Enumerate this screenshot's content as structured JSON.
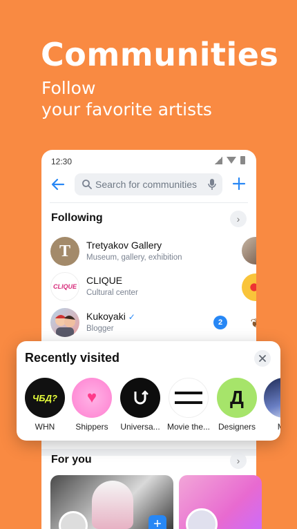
{
  "hero": {
    "title": "Communities",
    "subtitle_line1": "Follow",
    "subtitle_line2": "your favorite artists"
  },
  "status_bar": {
    "time": "12:30"
  },
  "search": {
    "placeholder": "Search for communities"
  },
  "following": {
    "title": "Following",
    "items": [
      {
        "name": "Tretyakov Gallery",
        "desc": "Museum, gallery, exhibition",
        "avatar_letter": "T"
      },
      {
        "name": "CLIQUE",
        "desc": "Cultural center",
        "avatar_text": "CLIQUE"
      },
      {
        "name": "Kukoyaki",
        "desc": "Blogger",
        "badge": "2",
        "verified": true
      }
    ]
  },
  "recently_visited": {
    "title": "Recently visited",
    "items": [
      {
        "label": "WHN",
        "avatar_text": "ЧБД?"
      },
      {
        "label": "Shippers"
      },
      {
        "label": "Universa..."
      },
      {
        "label": "Movie the..."
      },
      {
        "label": "Designers",
        "avatar_text": "Д"
      },
      {
        "label": "Мы"
      }
    ]
  },
  "for_you": {
    "title": "For you"
  },
  "colors": {
    "background": "#F98A42",
    "accent": "#2787F5"
  }
}
